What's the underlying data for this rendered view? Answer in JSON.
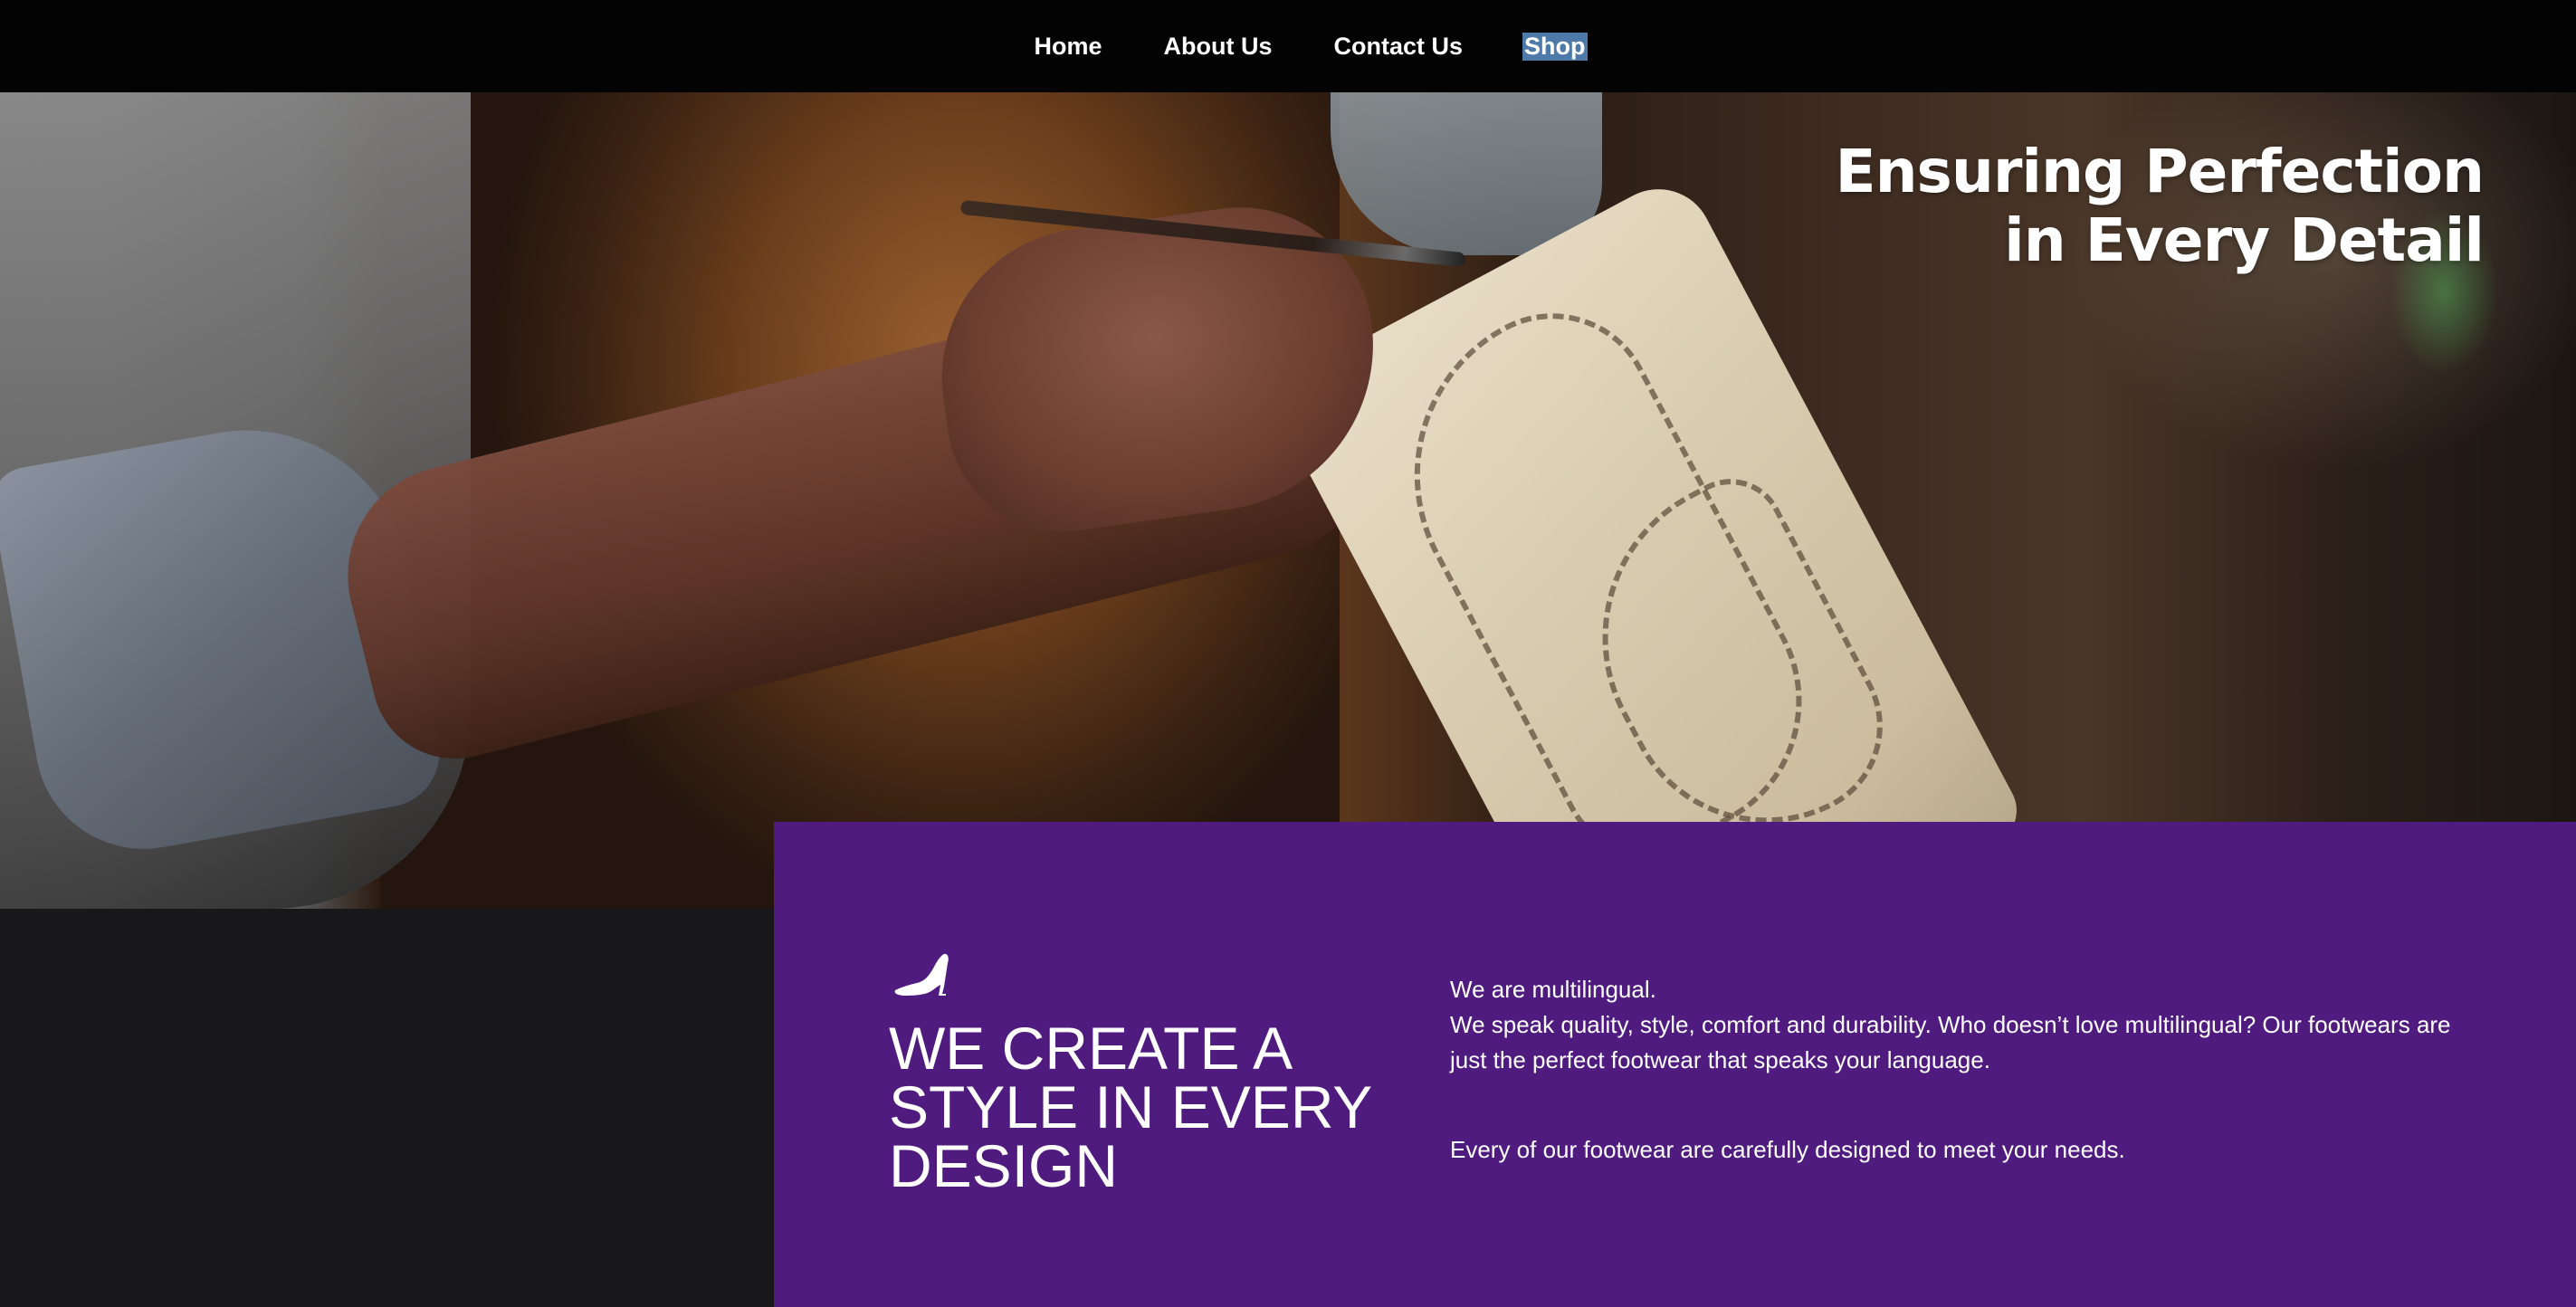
{
  "nav": {
    "items": [
      {
        "label": "Home"
      },
      {
        "label": "About Us"
      },
      {
        "label": "Contact Us"
      },
      {
        "label": "Shop"
      }
    ],
    "selected_index": 3
  },
  "hero": {
    "title_line1": "Ensuring Perfection",
    "title_line2": "in Every Detail"
  },
  "feature": {
    "icon": "high-heel-shoe-icon",
    "heading": "WE CREATE A STYLE IN EVERY DESIGN",
    "paragraph1_line1": "We are multilingual.",
    "paragraph1_line2": "We speak quality, style, comfort and durability. Who doesn’t love multilingual? Our footwears are just the perfect footwear that speaks your language.",
    "paragraph2": "Every of our footwear are carefully designed to meet your needs."
  },
  "colors": {
    "nav_background": "#030303",
    "selected_highlight": "#4d7aa8",
    "feature_panel": "#4f1b7f",
    "dark_band": "#18181b",
    "text": "#ffffff"
  }
}
